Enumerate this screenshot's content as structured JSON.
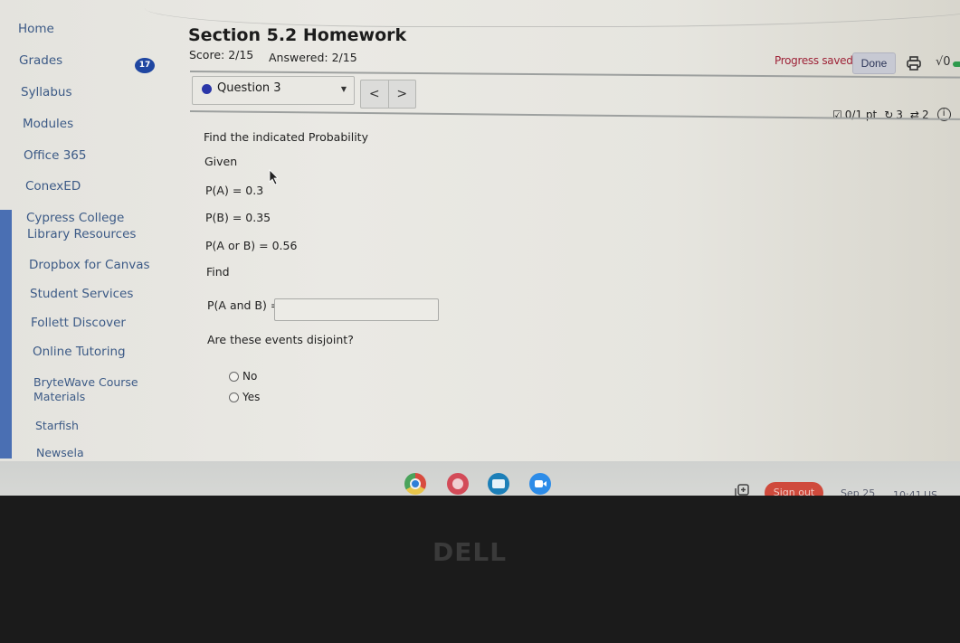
{
  "sidebar": {
    "items": [
      {
        "label": "Home"
      },
      {
        "label": "Grades",
        "badge": "17"
      },
      {
        "label": "Syllabus"
      },
      {
        "label": "Modules"
      },
      {
        "label": "Office 365"
      },
      {
        "label": "ConexED"
      },
      {
        "label": "Cypress College"
      },
      {
        "label": "Library Resources"
      },
      {
        "label": "Dropbox for Canvas"
      },
      {
        "label": "Student Services"
      },
      {
        "label": "Follett Discover"
      },
      {
        "label": "Online Tutoring"
      },
      {
        "label": "BryteWave Course"
      },
      {
        "label": "Materials"
      },
      {
        "label": "Starfish"
      },
      {
        "label": "Newsela"
      }
    ]
  },
  "header": {
    "title": "Section 5.2 Homework",
    "score": "Score: 2/15",
    "answered": "Answered: 2/15",
    "progress_status": "Progress saved",
    "done_label": "Done",
    "math_label": "√0"
  },
  "question_nav": {
    "selected": "Question 3",
    "prev_label": "<",
    "next_label": ">"
  },
  "question_meta": {
    "points": "0/1 pt",
    "retries": "3",
    "attempts": "2",
    "info": "i"
  },
  "question": {
    "prompt": "Find the indicated Probability",
    "given_label": "Given",
    "given": [
      "P(A) = 0.3",
      "P(B) = 0.35",
      "P(A or B) = 0.56"
    ],
    "find_label": "Find",
    "answer_label": "P(A and B) =",
    "answer_value": "",
    "disjoint_question": "Are these events disjoint?",
    "options": [
      "No",
      "Yes"
    ]
  },
  "shelf": {
    "apps": [
      "Chrome",
      "Canvas",
      "Classroom",
      "Zoom"
    ],
    "sign_out_label": "Sign out",
    "date": "Sep 25",
    "time": "10:41",
    "locale": "US"
  },
  "bezel": {
    "brand": "DELL"
  },
  "colors": {
    "link": "#3c5a86",
    "badge": "#1f46a1",
    "progress_saved": "#9e2338",
    "sign_out": "#cf4a3c"
  }
}
